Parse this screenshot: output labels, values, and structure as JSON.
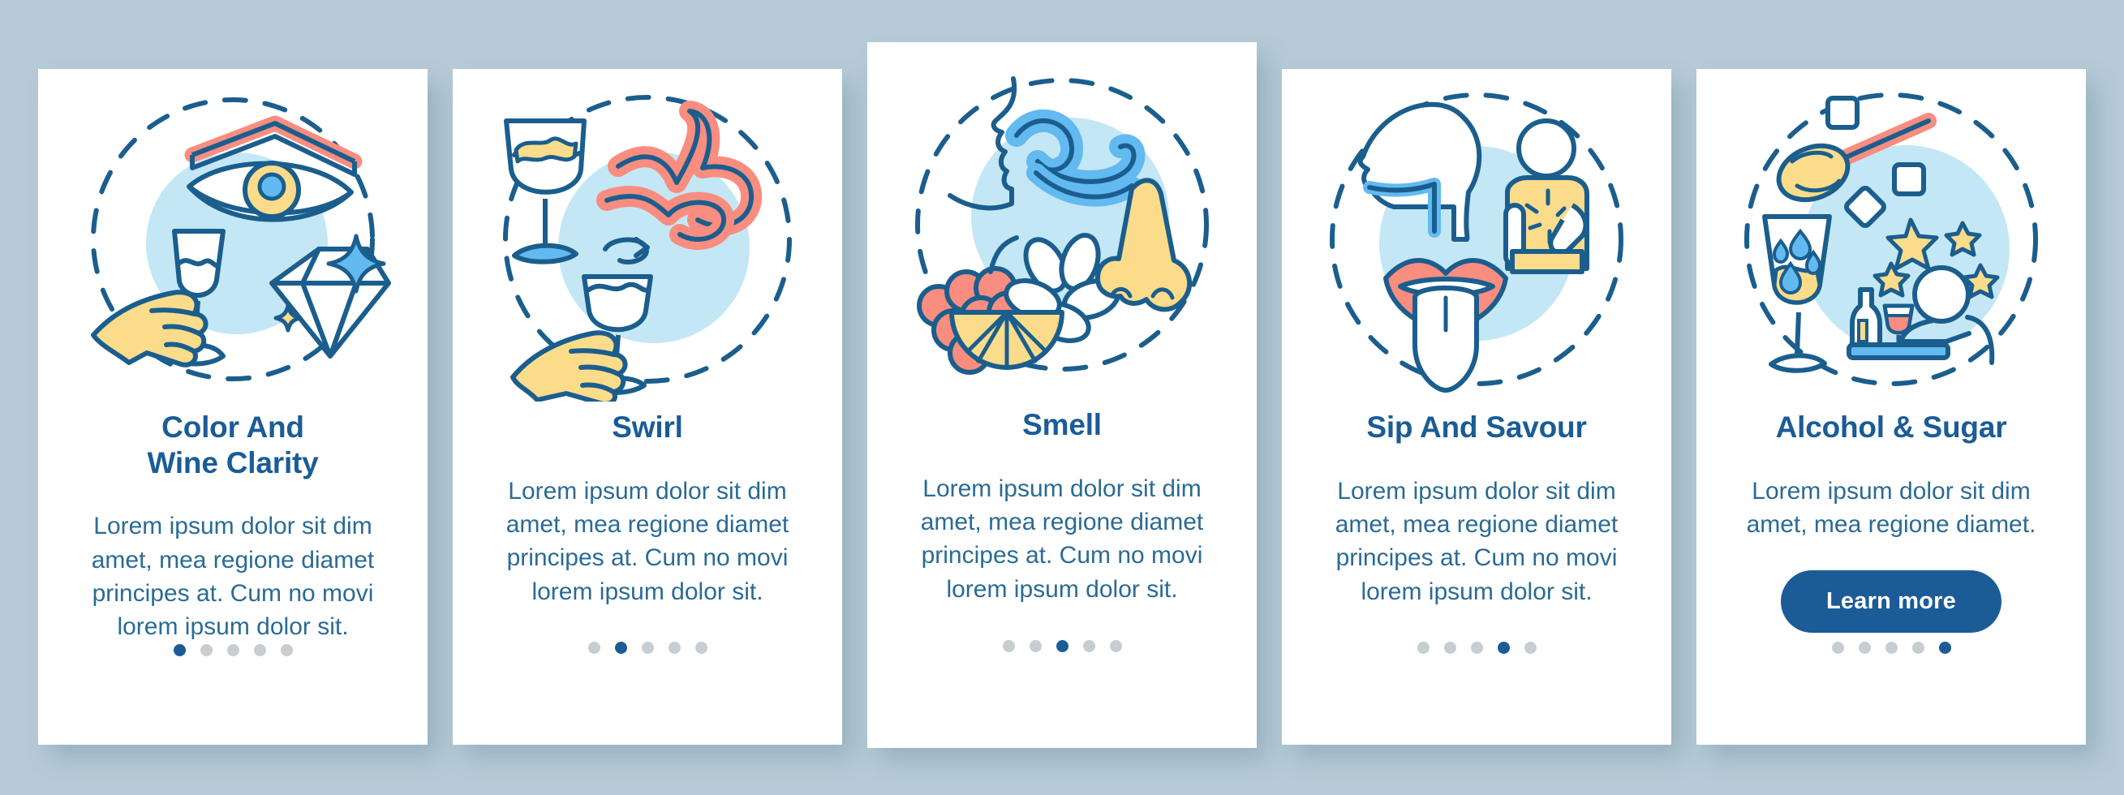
{
  "theme": {
    "background": "#b6cbd7",
    "card_background": "#ffffff",
    "title_color": "#1a5c96",
    "body_color": "#2a6b94",
    "accent_blue": "#1c5c96",
    "light_blue_circle": "#c4e7f5",
    "coral": "#f98d7f",
    "yellow": "#fbdc8a",
    "outline": "#1b5e8e",
    "dot_inactive": "#c8cdd1"
  },
  "body_text_long": "Lorem ipsum dolor sit dim amet, mea regione diamet principes at. Cum no movi lorem ipsum dolor sit.",
  "body_text_short": "Lorem ipsum dolor sit dim amet, mea regione diamet.",
  "total_steps": 5,
  "cards": [
    {
      "id": "color-and-wine-clarity",
      "title": "Color And\nWine Clarity",
      "body": "Lorem ipsum dolor sit dim amet, mea regione diamet principes at. Cum no movi lorem ipsum dolor sit.",
      "active_dot": 1,
      "illustration": "eye-wineglass-diamond-icon",
      "has_button": false,
      "button_label": "",
      "size": "standard"
    },
    {
      "id": "swirl",
      "title": "Swirl",
      "body": "Lorem ipsum dolor sit dim amet, mea regione diamet principes at. Cum no movi lorem ipsum dolor sit.",
      "active_dot": 2,
      "illustration": "swirling-wineglass-icon",
      "has_button": false,
      "button_label": "",
      "size": "standard"
    },
    {
      "id": "smell",
      "title": "Smell",
      "body": "Lorem ipsum dolor sit dim amet, mea regione diamet principes at. Cum no movi lorem ipsum dolor sit.",
      "active_dot": 3,
      "illustration": "nose-aroma-fruit-icon",
      "has_button": false,
      "button_label": "",
      "size": "tall"
    },
    {
      "id": "sip-and-savour",
      "title": "Sip And Savour",
      "body": "Lorem ipsum dolor sit dim amet, mea regione diamet principes at. Cum no movi lorem ipsum dolor sit.",
      "active_dot": 4,
      "illustration": "mouth-throat-taste-icon",
      "has_button": false,
      "button_label": "",
      "size": "standard"
    },
    {
      "id": "alcohol-and-sugar",
      "title": "Alcohol & Sugar",
      "body": "Lorem ipsum dolor sit dim amet, mea regione diamet.",
      "active_dot": 5,
      "illustration": "sugar-spoon-wineglass-icon",
      "has_button": true,
      "button_label": "Learn more",
      "size": "standard"
    }
  ]
}
